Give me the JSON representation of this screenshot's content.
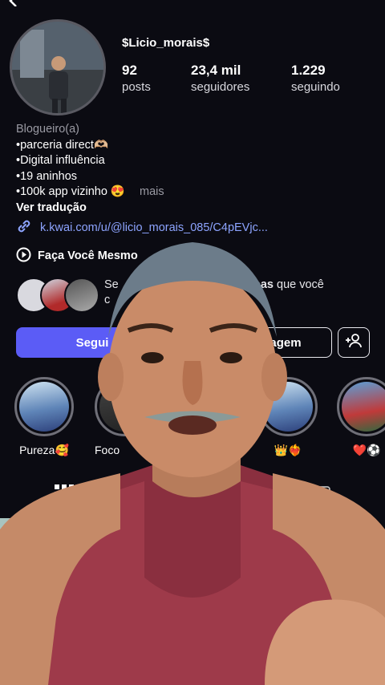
{
  "profile": {
    "username": "$Licio_morais$",
    "stats": [
      {
        "value": "92",
        "label": "posts"
      },
      {
        "value": "23,4 mil",
        "label": "seguidores"
      },
      {
        "value": "1.229",
        "label": "seguindo"
      }
    ],
    "category": "Blogueiro(a)",
    "bio_lines": [
      "•parceria direct🫶🏼",
      "•Digital influência",
      "•19 aninhos",
      "•100k app vizinho 😍"
    ],
    "more_label": "mais",
    "translate_label": "Ver tradução",
    "link_text": "k.kwai.com/u/@licio_morais_085/C4pEVjc...",
    "playlist_label": "Faça Você Mesmo",
    "mutual_text_start": "Se",
    "mutual_text_bold": "essoas",
    "mutual_text_end": "que você",
    "mutual_text_line2": "c"
  },
  "actions": {
    "follow_label": "Segui",
    "message_label": "agem"
  },
  "highlights": [
    {
      "label": "Pureza🥰"
    },
    {
      "label": "Foco"
    },
    {
      "label": "👑❤️‍🔥"
    },
    {
      "label": "❤️⚽"
    }
  ],
  "colors": {
    "accent": "#5b5cf6",
    "link": "#8da4ff",
    "background": "#0b0b12"
  }
}
